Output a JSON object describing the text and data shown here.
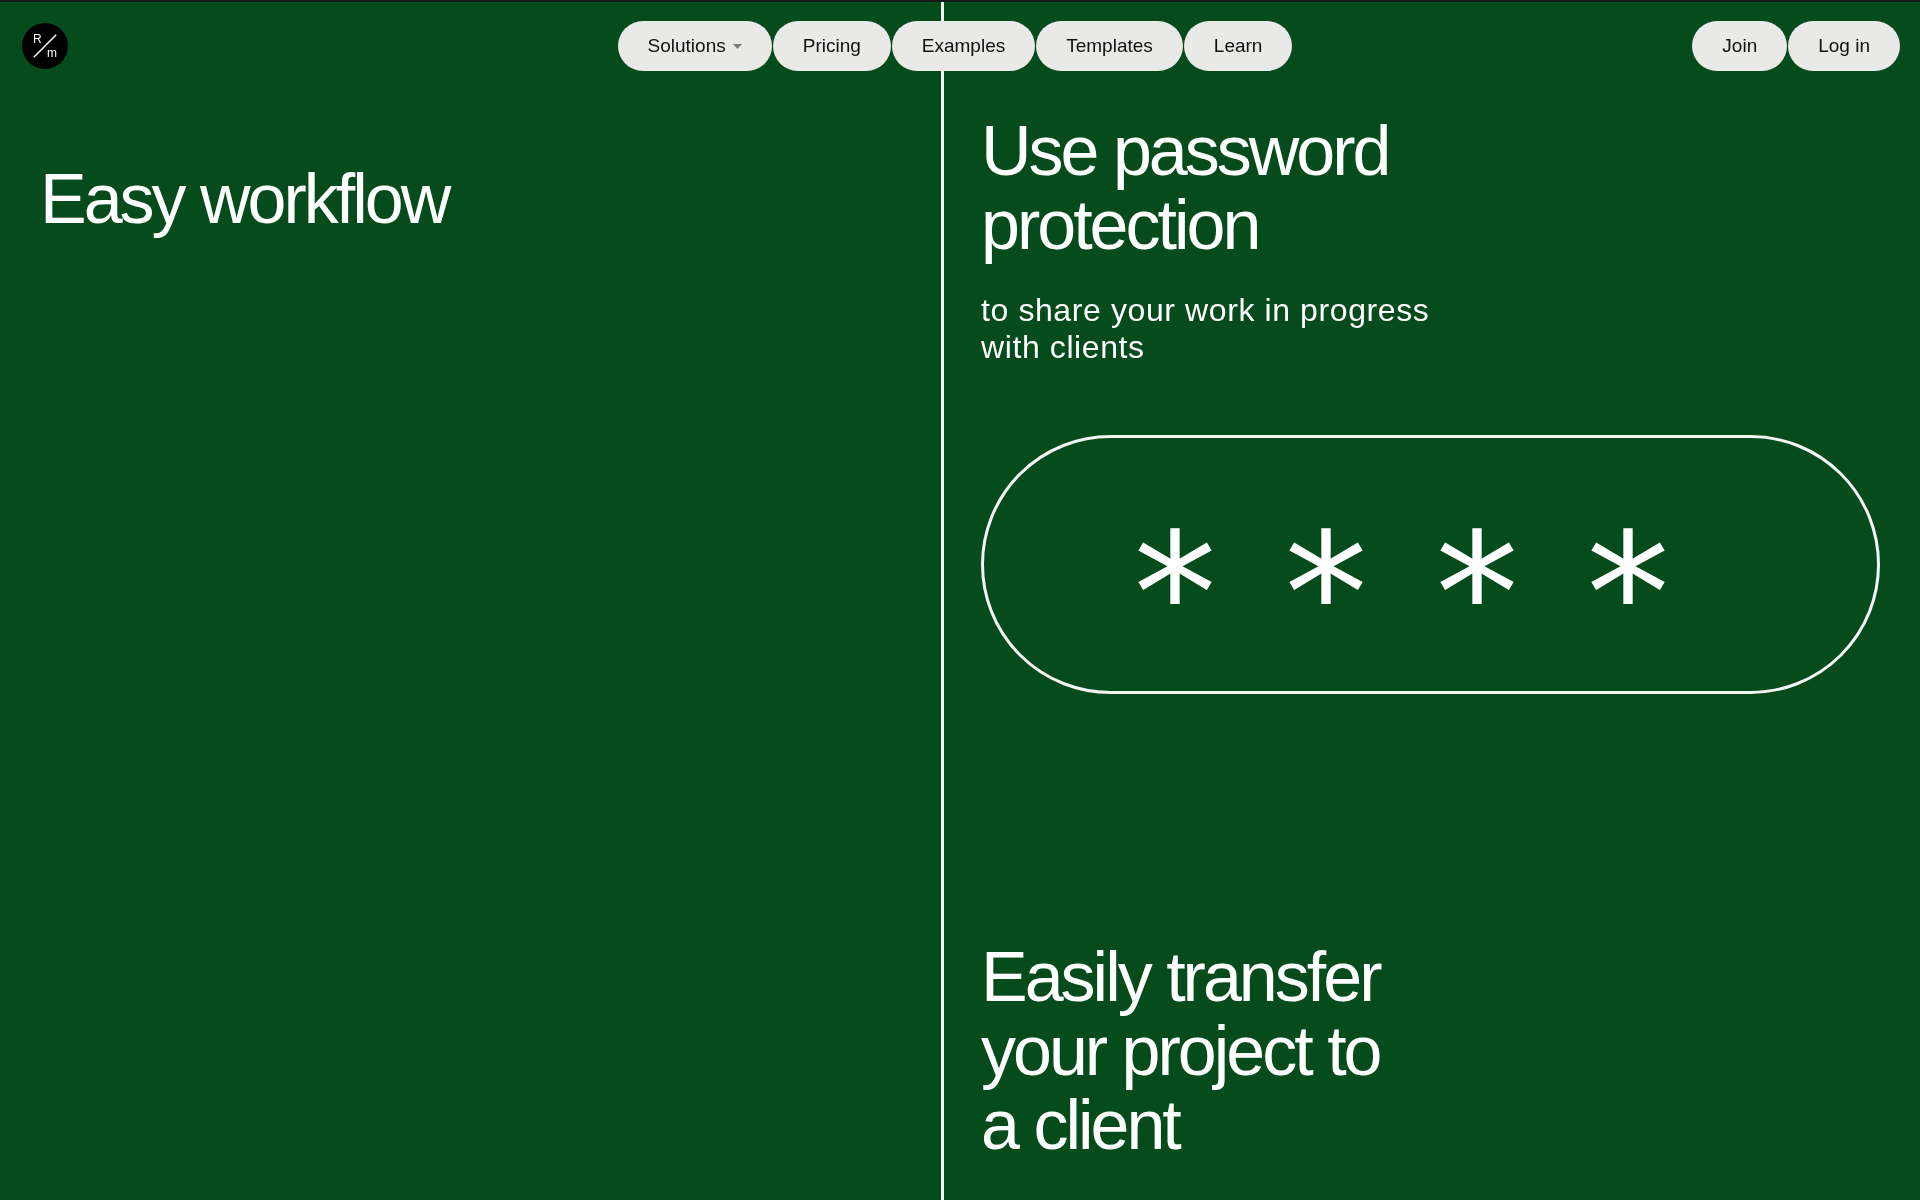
{
  "header": {
    "logo": {
      "top_letter": "R",
      "bottom_letter": "m"
    },
    "nav": [
      {
        "label": "Solutions",
        "kind": "dropdown"
      },
      {
        "label": "Pricing",
        "kind": "link"
      },
      {
        "label": "Examples",
        "kind": "link"
      },
      {
        "label": "Templates",
        "kind": "link"
      },
      {
        "label": "Learn",
        "kind": "link"
      }
    ],
    "account_buttons": [
      "Join",
      "Log in"
    ]
  },
  "left_panel": {
    "heading": "Easy workflow"
  },
  "right_panel": {
    "sections": [
      {
        "heading": "Use password protection",
        "text": "to share your work in progress with clients",
        "password_field": {
          "value": "****"
        }
      },
      {
        "heading": "Easily transfer your project to a client"
      }
    ]
  }
}
